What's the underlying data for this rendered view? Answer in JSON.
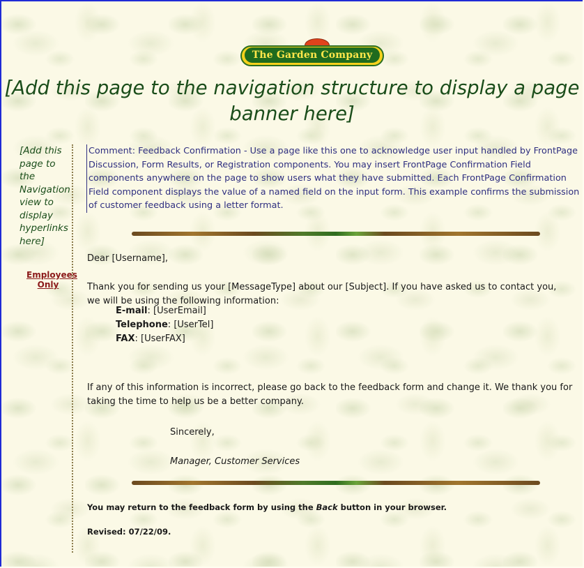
{
  "logo": {
    "text": "The Garden Company"
  },
  "banner": {
    "text": "[Add this page to the navigation structure to display a page banner here]"
  },
  "sidebar": {
    "placeholder": "[Add this page to the Navigation view to display hyperlinks here]",
    "link": "Employees Only"
  },
  "comment": "Comment: Feedback Confirmation - Use a page like this one to acknowledge user input handled by FrontPage Discussion, Form Results, or Registration components. You may insert FrontPage Confirmation Field components anywhere on the page to show users what they have submitted. Each FrontPage Confirmation Field component displays the value of a named field on the input form. This example confirms the submission of customer feedback using a letter format.",
  "letter": {
    "greeting": "Dear [Username],",
    "intro": "Thank you for sending us your [MessageType] about our [Subject]. If you have asked us to contact you, we will be using the following information:",
    "email_label": "E-mail",
    "email_value": "[UserEmail]",
    "tel_label": "Telephone",
    "tel_value": "[UserTel]",
    "fax_label": "FAX",
    "fax_value": "[UserFAX]",
    "outro": "If any of this information is incorrect, please go back to the feedback form and change it. We thank you for taking the time to help us be a better company.",
    "closing": "Sincerely,",
    "signature": "Manager, Customer Services"
  },
  "footer": {
    "return_pre": "You may return to the feedback form by using the ",
    "return_em": "Back",
    "return_post": " button in your browser.",
    "revised": "Revised: 07/22/09."
  }
}
